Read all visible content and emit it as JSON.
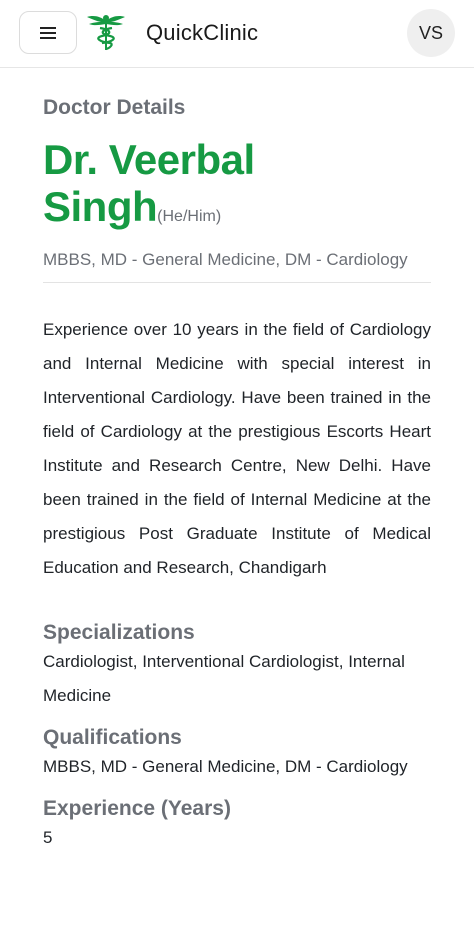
{
  "header": {
    "brand": "QuickClinic",
    "avatar_initials": "VS",
    "menu_icon": "hamburger-menu-icon",
    "logo_icon": "caduceus-icon",
    "brand_color": "#169a43"
  },
  "page": {
    "section_title": "Doctor Details"
  },
  "doctor": {
    "name_line1": "Dr. Veerbal",
    "name_line2": "Singh",
    "pronouns": "(He/Him)",
    "qualifications_short": "MBBS, MD - General Medicine, DM - Cardiology",
    "bio": "Experience over 10 years in the field of Cardiology and Internal Medicine with special interest in Interventional Cardiology. Have been trained in the field of Cardiology at the prestigious Escorts Heart Institute and Research Centre, New Delhi. Have been trained in the field of Internal Medicine at the prestigious Post Graduate Institute of Medical Education and Research, Chandigarh"
  },
  "details": {
    "specializations_title": "Specializations",
    "specializations_value": "Cardiologist, Interventional Cardiologist, Internal Medicine",
    "qualifications_title": "Qualifications",
    "qualifications_value": "MBBS, MD - General Medicine, DM - Cardiology",
    "experience_title": "Experience (Years)",
    "experience_value": "5"
  }
}
